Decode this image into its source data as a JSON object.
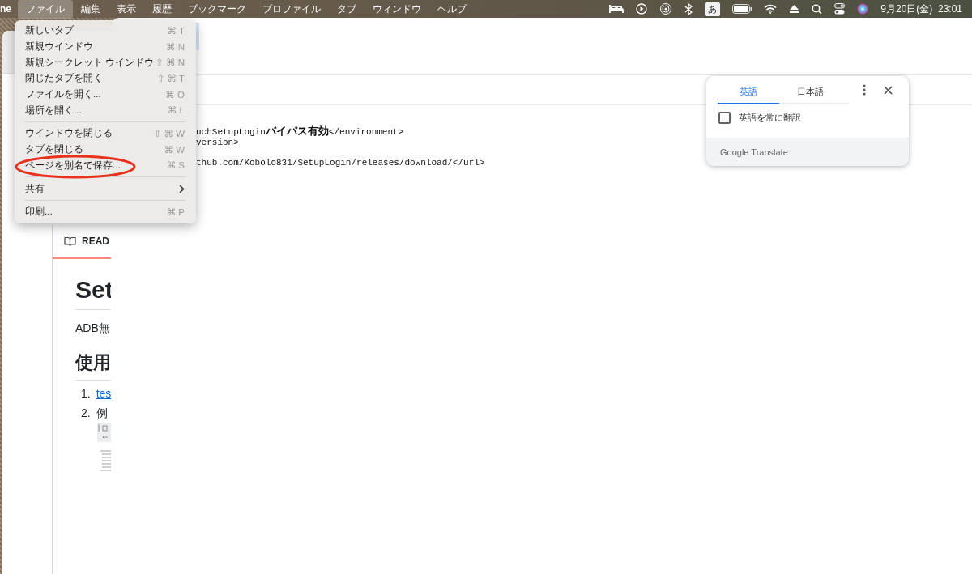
{
  "menubar": {
    "app_name": "ne",
    "menus": [
      {
        "label": "ファイル",
        "selected": true
      },
      {
        "label": "編集",
        "selected": false
      },
      {
        "label": "表示",
        "selected": false
      },
      {
        "label": "履歴",
        "selected": false
      },
      {
        "label": "ブックマーク",
        "selected": false
      },
      {
        "label": "プロファイル",
        "selected": false
      },
      {
        "label": "タブ",
        "selected": false
      },
      {
        "label": "ウィンドウ",
        "selected": false
      },
      {
        "label": "ヘルプ",
        "selected": false
      }
    ],
    "input_indicator": "あ",
    "clock": "9月20日(金)  23:01"
  },
  "file_menu": {
    "items": [
      {
        "kind": "item",
        "label": "新しいタブ",
        "shortcut": "⌘ T",
        "circled": false
      },
      {
        "kind": "item",
        "label": "新規ウインドウ",
        "shortcut": "⌘ N",
        "circled": false
      },
      {
        "kind": "item",
        "label": "新規シークレット ウインドウ",
        "shortcut": "⇧ ⌘ N",
        "circled": false
      },
      {
        "kind": "item",
        "label": "閉じたタブを開く",
        "shortcut": "⇧ ⌘ T",
        "circled": false
      },
      {
        "kind": "item",
        "label": "ファイルを開く...",
        "shortcut": "⌘ O",
        "circled": false
      },
      {
        "kind": "item",
        "label": "場所を開く...",
        "shortcut": "⌘ L",
        "circled": false
      },
      {
        "kind": "separator"
      },
      {
        "kind": "item",
        "label": "ウインドウを閉じる",
        "shortcut": "⇧ ⌘ W",
        "circled": false
      },
      {
        "kind": "item",
        "label": "タブを閉じる",
        "shortcut": "⌘ W",
        "circled": false
      },
      {
        "kind": "item",
        "label": "ページを別名で保存...",
        "shortcut": "⌘ S",
        "circled": true
      },
      {
        "kind": "separator"
      },
      {
        "kind": "submenu",
        "label": "共有",
        "circled": false
      },
      {
        "kind": "separator"
      },
      {
        "kind": "item",
        "label": "印刷...",
        "shortcut": "⌘ P",
        "circled": false
      }
    ]
  },
  "background_window": {
    "readme_tab": "READ",
    "heading": "Set",
    "paragraph": "ADB無",
    "subheading": "使用",
    "list": [
      {
        "number": "1.",
        "text": "tes",
        "kind": "link"
      },
      {
        "number": "2.",
        "text": "例",
        "kind": "text"
      }
    ]
  },
  "page": {
    "code_lines": [
      "uchSetupLogin**バイパス有効**</environment>",
      "version>",
      "thub.com/Kobold831/SetupLogin/releases/download/</url>"
    ]
  },
  "translate_popup": {
    "tabs": [
      {
        "label": "英語",
        "selected": true
      },
      {
        "label": "日本語",
        "selected": false
      }
    ],
    "always_translate": {
      "label": "英語を常に翻訳",
      "checked": false
    },
    "footer": "Google Translate"
  }
}
